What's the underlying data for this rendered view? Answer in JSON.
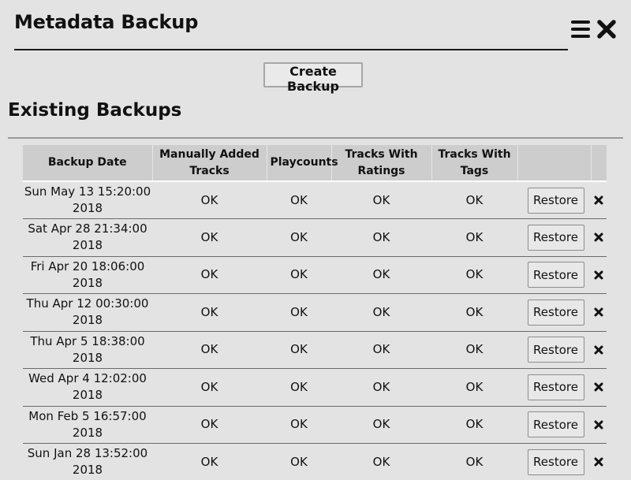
{
  "header": {
    "title": "Metadata Backup",
    "menu_icon": "hamburger-menu-icon",
    "close_icon": "close-x-icon"
  },
  "actions": {
    "create_backup_label": "Create Backup"
  },
  "section": {
    "title": "Existing Backups"
  },
  "table": {
    "columns": [
      "Backup Date",
      "Manually Added Tracks",
      "Playcounts",
      "Tracks With Ratings",
      "Tracks With Tags",
      "",
      ""
    ],
    "restore_label": "Restore",
    "delete_icon": "delete-x-icon",
    "rows": [
      {
        "date_line1": "Sun May 13 15:20:00",
        "date_line2": "2018",
        "manual": "OK",
        "playcounts": "OK",
        "ratings": "OK",
        "tags": "OK"
      },
      {
        "date_line1": "Sat Apr 28 21:34:00",
        "date_line2": "2018",
        "manual": "OK",
        "playcounts": "OK",
        "ratings": "OK",
        "tags": "OK"
      },
      {
        "date_line1": "Fri Apr 20 18:06:00",
        "date_line2": "2018",
        "manual": "OK",
        "playcounts": "OK",
        "ratings": "OK",
        "tags": "OK"
      },
      {
        "date_line1": "Thu Apr 12 00:30:00",
        "date_line2": "2018",
        "manual": "OK",
        "playcounts": "OK",
        "ratings": "OK",
        "tags": "OK"
      },
      {
        "date_line1": "Thu Apr 5 18:38:00",
        "date_line2": "2018",
        "manual": "OK",
        "playcounts": "OK",
        "ratings": "OK",
        "tags": "OK"
      },
      {
        "date_line1": "Wed Apr 4 12:02:00",
        "date_line2": "2018",
        "manual": "OK",
        "playcounts": "OK",
        "ratings": "OK",
        "tags": "OK"
      },
      {
        "date_line1": "Mon Feb 5 16:57:00",
        "date_line2": "2018",
        "manual": "OK",
        "playcounts": "OK",
        "ratings": "OK",
        "tags": "OK"
      },
      {
        "date_line1": "Sun Jan 28 13:52:00",
        "date_line2": "2018",
        "manual": "OK",
        "playcounts": "OK",
        "ratings": "OK",
        "tags": "OK"
      }
    ]
  }
}
